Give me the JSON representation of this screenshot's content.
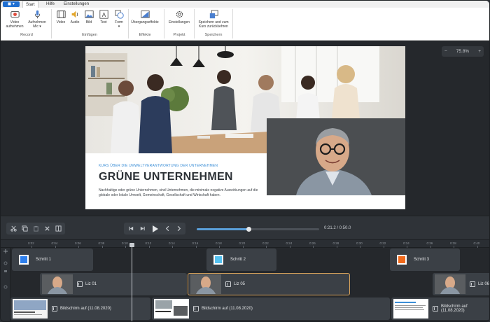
{
  "ribbon": {
    "file_menu_label": "▾",
    "tabs": [
      {
        "label": "Start",
        "active": true
      },
      {
        "label": "Hilfe",
        "active": false
      },
      {
        "label": "Einstellungen",
        "active": false
      }
    ],
    "buttons": {
      "video_record": "Video\naufnehmen",
      "audio_record": "Aufnehmen\nMic ▾",
      "video": "Video",
      "audio": "Audio",
      "image": "Bild",
      "text": "Text",
      "shape": "Form\n▾",
      "transitions": "Übergangseffekte",
      "settings": "Einstellungen",
      "save_return": "Speichern und zum\nKurs zurückkehren"
    },
    "groups": {
      "record": "Record",
      "insert": "Einfügen",
      "effects": "Effekte",
      "project": "Projekt",
      "save": "Speichern"
    }
  },
  "preview": {
    "zoom_minus": "−",
    "zoom_level": "75.8%",
    "zoom_plus": "+",
    "slide": {
      "kicker": "KURS ÜBER DIE UMWELTVERANTWORTUNG DER UNTERNEHMEN",
      "headline": "GRÜNE UNTERNEHMEN",
      "body": "Nachhaltige oder grüne Unternehmen, sind Unternehmen, die minimale negative Auswirkungen auf die globale oder lokale Umwelt, Gemeinschaft, Gesellschaft und Wirtschaft haben."
    }
  },
  "transport": {
    "time": "0:21.2 / 0:50.0",
    "progress": 0.424
  },
  "timeline": {
    "ticks": [
      "0:02",
      "0:04",
      "0:06",
      "0:08",
      "0:10",
      "0:12",
      "0:14",
      "0:16",
      "0:18",
      "0:20",
      "0:22",
      "0:24",
      "0:26",
      "0:28",
      "0:30",
      "0:32",
      "0:34",
      "0:36",
      "0:38",
      "0:40"
    ],
    "step_clips": [
      {
        "label": "Schritt 1",
        "color": "#2f80ed"
      },
      {
        "label": "Schritt 2",
        "color": "#56c2f0"
      },
      {
        "label": "Schritt 3",
        "color": "#f26a1b"
      }
    ],
    "camera_clips": [
      {
        "label": "Liz 01"
      },
      {
        "label": "Liz 05"
      },
      {
        "label": "Liz 06"
      }
    ],
    "screen_clips": [
      {
        "label": "Bildschirm auf (11.08.2020)"
      },
      {
        "label": "Bildschirm auf (11.08.2020)"
      },
      {
        "label": "Bildschirm auf (11.08.2020)"
      }
    ]
  }
}
